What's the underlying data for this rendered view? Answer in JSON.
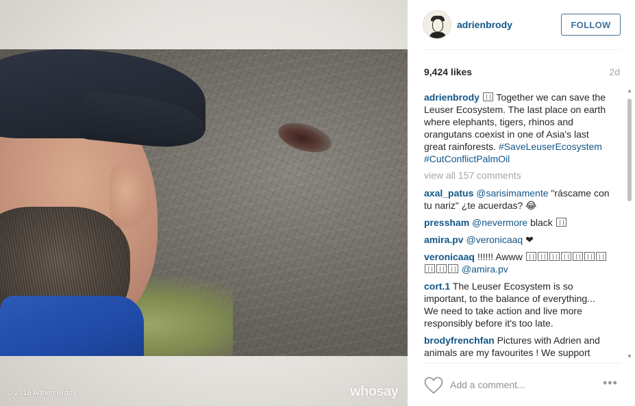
{
  "photo": {
    "copyright": "© 2016 Adrien Brody",
    "watermark": "whosay"
  },
  "header": {
    "username": "adrienbrody",
    "follow_label": "FOLLOW"
  },
  "stats": {
    "likes": "9,424 likes",
    "age": "2d"
  },
  "caption": {
    "user": "adrienbrody",
    "text": " Together we can save the Leuser Ecosystem. The last place on earth where elephants, tigers, rhinos and orangutans coexist in one of Asia's last great rainforests. ",
    "hashtag1": "#SaveLeuserEcosystem",
    "hashtag2": "#CutConflictPalmOil"
  },
  "view_all": "view all 157 comments",
  "comments": [
    {
      "user": "axal_patus",
      "mention": "@sarisimamente",
      "text": " \"ráscame con tu nariz\" ¿te acuerdas? 😂"
    },
    {
      "user": "pressham",
      "mention": "@nevermore",
      "text": "  black "
    },
    {
      "user": "amira.pv",
      "mention": "@veronicaaq",
      "text": " ❤"
    },
    {
      "user": "veronicaaq",
      "text": " !!!!!! Awww",
      "mention": "@amira.pv"
    },
    {
      "user": "cort.1",
      "text": " The Leuser Ecosystem is so important, to the balance of everything... We need to take action and live more responsibly before it's too late."
    },
    {
      "user": "brodyfrenchfan",
      "text": " Pictures with Adrien and animals are my favourites ! We support"
    }
  ],
  "footer": {
    "comment_placeholder": "Add a comment...",
    "more_label": "•••"
  },
  "colors": {
    "link": "#125688",
    "follow": "#3f729b",
    "muted": "#a5a7aa"
  }
}
